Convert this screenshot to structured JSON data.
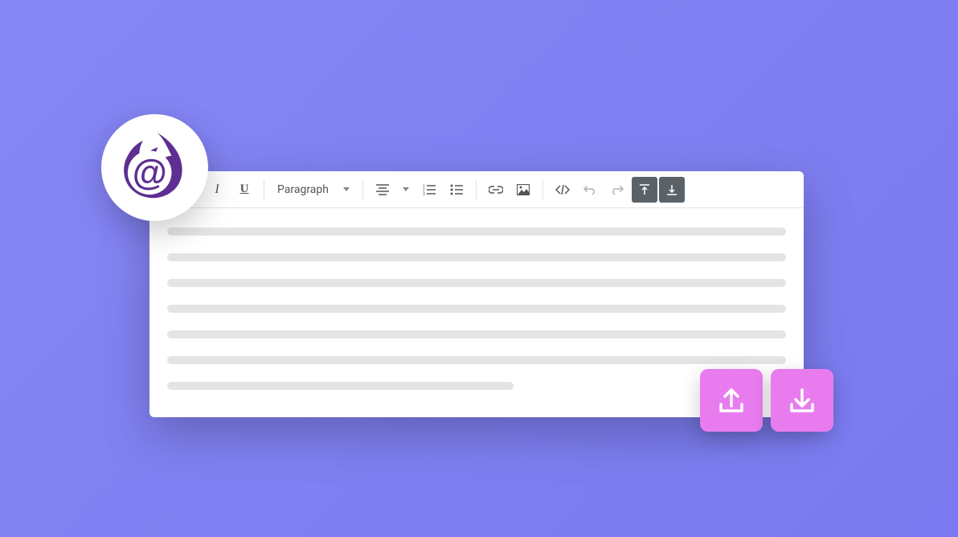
{
  "toolbar": {
    "italic_label": "I",
    "underline_label": "U",
    "format_select_label": "Paragraph"
  },
  "colors": {
    "background": "#7d7df2",
    "logo_purple": "#5e2e91",
    "pink_button": "#e87cef",
    "dark_button": "#5a6268"
  }
}
